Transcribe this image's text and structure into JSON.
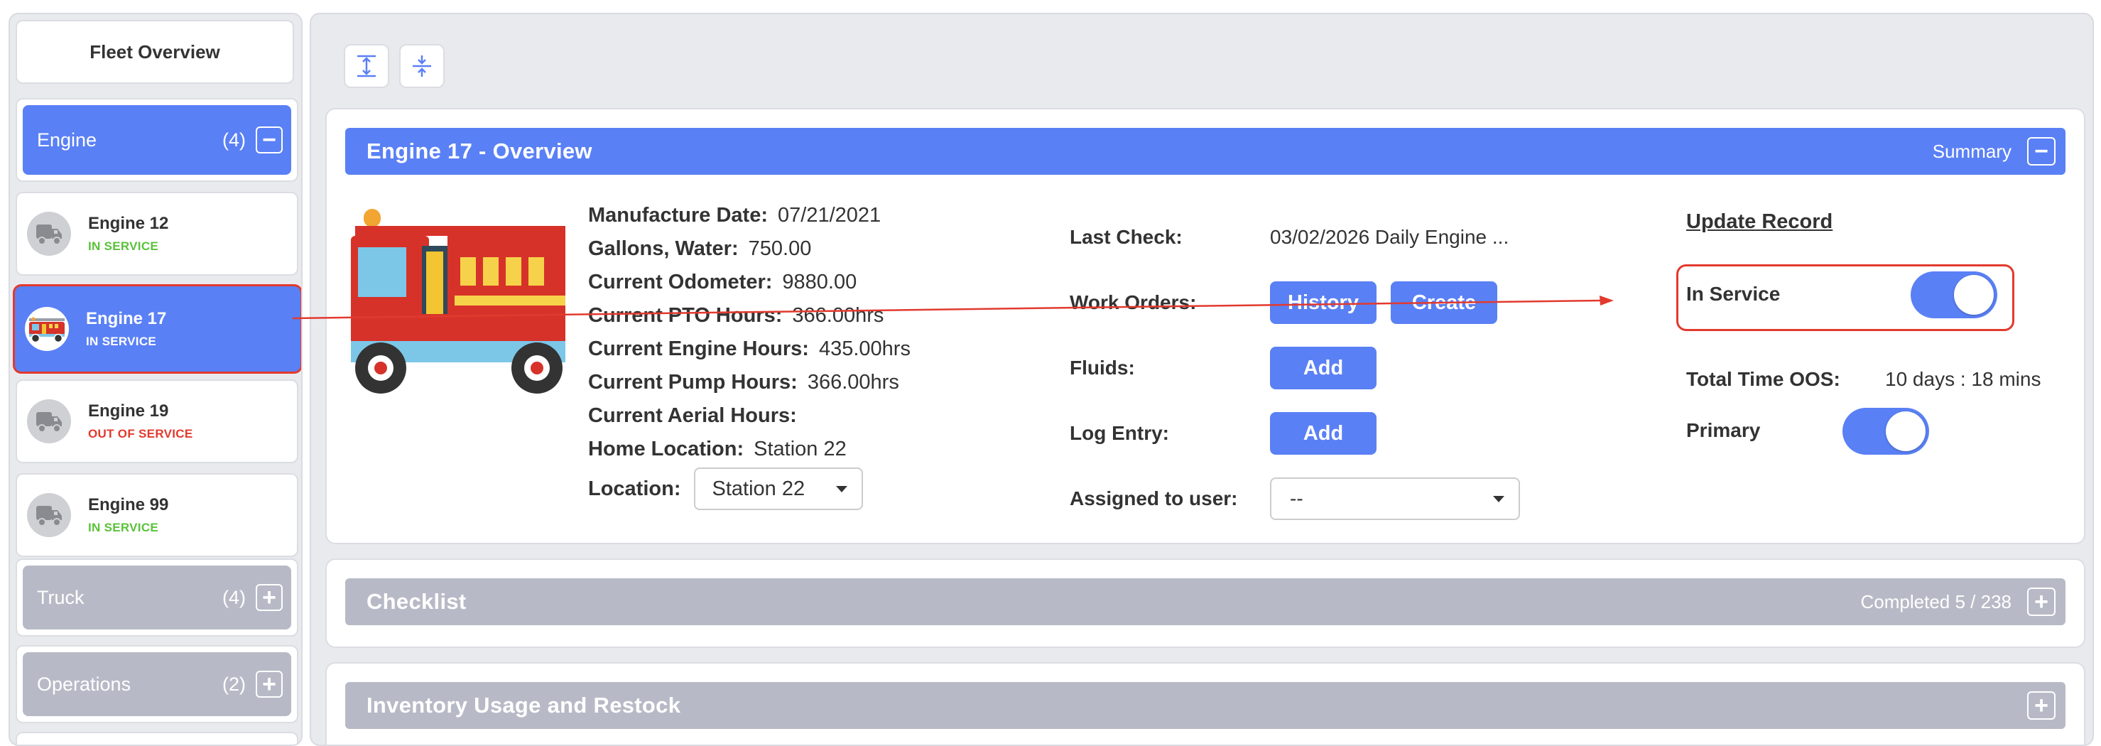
{
  "sidebar": {
    "fleet_overview_label": "Fleet Overview",
    "categories": [
      {
        "label": "Engine",
        "count": "(4)",
        "toggle": "−"
      },
      {
        "label": "Truck",
        "count": "(4)",
        "toggle": "+"
      },
      {
        "label": "Operations",
        "count": "(2)",
        "toggle": "+"
      }
    ],
    "units": [
      {
        "name": "Engine 12",
        "status": "IN SERVICE",
        "avatar_icon": "truck-icon"
      },
      {
        "name": "Engine 17",
        "status": "IN SERVICE",
        "avatar_icon": "fire-truck-icon"
      },
      {
        "name": "Engine 19",
        "status": "OUT OF SERVICE",
        "avatar_icon": "truck-icon"
      },
      {
        "name": "Engine 99",
        "status": "IN SERVICE",
        "avatar_icon": "truck-icon"
      }
    ]
  },
  "toolbar": {
    "expand_icon": "expand-all-icon",
    "collapse_icon": "collapse-all-icon"
  },
  "overview": {
    "title": "Engine 17 - Overview",
    "summary_label": "Summary",
    "toggle": "−",
    "details": [
      {
        "label": "Manufacture Date:",
        "value": "07/21/2021"
      },
      {
        "label": "Gallons, Water:",
        "value": "750.00"
      },
      {
        "label": "Current Odometer:",
        "value": "9880.00"
      },
      {
        "label": "Current PTO Hours:",
        "value": "366.00hrs"
      },
      {
        "label": "Current Engine Hours:",
        "value": "435.00hrs"
      },
      {
        "label": "Current Pump Hours:",
        "value": "366.00hrs"
      },
      {
        "label": "Current Aerial Hours:",
        "value": ""
      },
      {
        "label": "Home Location:",
        "value": "Station 22"
      }
    ],
    "location_label": "Location:",
    "location_value": "Station 22",
    "last_check_label": "Last Check:",
    "last_check_value": "03/02/2026 Daily Engine ...",
    "work_orders_label": "Work Orders:",
    "history_button": "History",
    "create_button": "Create",
    "fluids_label": "Fluids:",
    "fluids_add": "Add",
    "log_entry_label": "Log Entry:",
    "log_add": "Add",
    "assigned_label": "Assigned to user:",
    "assigned_value": "--",
    "update_record": "Update Record",
    "in_service_label": "In Service",
    "in_service_on": true,
    "oos_label": "Total Time OOS:",
    "oos_value": "10 days : 18 mins",
    "primary_label": "Primary",
    "primary_on": true
  },
  "checklist": {
    "title": "Checklist",
    "status": "Completed 5 / 238",
    "toggle": "+"
  },
  "inventory": {
    "title": "Inventory Usage and Restock",
    "toggle": "+"
  },
  "colors": {
    "accent": "#5a80f5",
    "grey": "#b7bac6",
    "in_service": "#5ac23a",
    "out_of_service": "#e23a2e",
    "annotation": "#e23a2e"
  }
}
